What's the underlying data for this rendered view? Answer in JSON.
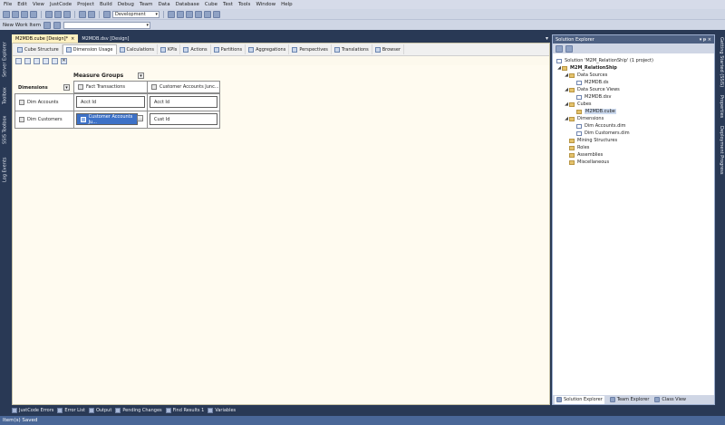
{
  "menu": [
    "File",
    "Edit",
    "View",
    "JustCode",
    "Project",
    "Build",
    "Debug",
    "Team",
    "Data",
    "Database",
    "Cube",
    "Test",
    "Tools",
    "Window",
    "Help"
  ],
  "toolbar": {
    "config_value": "Development",
    "new_work_item": "New Work Item"
  },
  "left_panels": [
    "Server Explorer",
    "Toolbox",
    "SSIS Toolbox",
    "Log Events"
  ],
  "right_panels": [
    "Getting Started (SSIS)",
    "Properties",
    "Deployment Progress"
  ],
  "doc_tabs": [
    {
      "label": "M2MDB.cube [Design]*",
      "close": "×"
    },
    {
      "label": "M2MDB.dsv [Design]"
    }
  ],
  "design_tabs": [
    "Cube Structure",
    "Dimension Usage",
    "Calculations",
    "KPIs",
    "Actions",
    "Partitions",
    "Aggregations",
    "Perspectives",
    "Translations",
    "Browser"
  ],
  "grid": {
    "measure_groups_header": "Measure Groups",
    "dimensions_header": "Dimensions",
    "measure_groups": [
      "Fact Transactions",
      "Customer Accounts Junc..."
    ],
    "rows": [
      {
        "dimension": "Dim Accounts",
        "cells": [
          "Acct Id",
          "Acct Id"
        ]
      },
      {
        "dimension": "Dim Customers",
        "cells": [
          "Customer Accounts Ju...",
          "Cust Id"
        ]
      }
    ]
  },
  "solution_explorer": {
    "title": "Solution Explorer",
    "pin": "▾ ᵽ ×",
    "solution": "Solution 'M2M_RelationShip' (1 project)",
    "project": "M2M_RelationShip",
    "nodes": {
      "data_sources": "Data Sources",
      "ds_file": "M2MDB.ds",
      "dsv": "Data Source Views",
      "dsv_file": "M2MDB.dsv",
      "cubes": "Cubes",
      "cube_file": "M2MDB.cube",
      "dimensions": "Dimensions",
      "dim1": "Dim Accounts.dim",
      "dim2": "Dim Customers.dim",
      "mining": "Mining Structures",
      "roles": "Roles",
      "assemblies": "Assemblies",
      "misc": "Miscellaneous"
    },
    "bottom_tabs": [
      "Solution Explorer",
      "Team Explorer",
      "Class View"
    ]
  },
  "bottom_tabs": [
    "JustCode Errors",
    "Error List",
    "Output",
    "Pending Changes",
    "Find Results 1",
    "Variables"
  ],
  "status": "Item(s) Saved",
  "colors": {
    "frame": "#293955",
    "designer_bg": "#fffbf0",
    "selection": "#3d71c7",
    "statusbar": "#4a6797"
  }
}
